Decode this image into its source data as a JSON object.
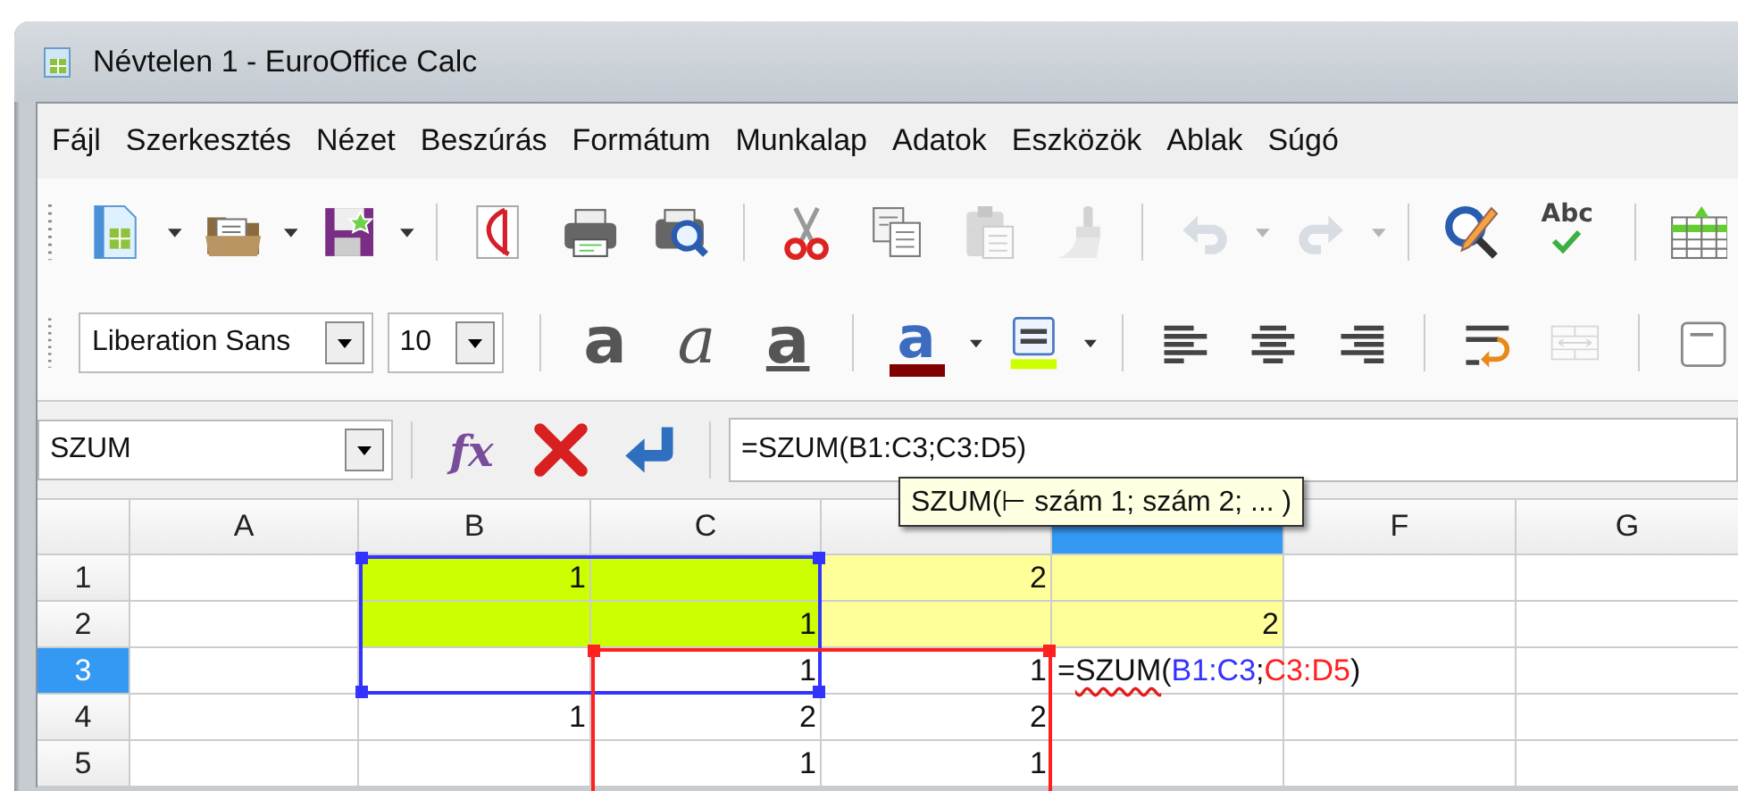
{
  "window": {
    "title": "Névtelen 1 - EuroOffice Calc"
  },
  "menu": [
    "Fájl",
    "Szerkesztés",
    "Nézet",
    "Beszúrás",
    "Formátum",
    "Munkalap",
    "Adatok",
    "Eszközök",
    "Ablak",
    "Súgó"
  ],
  "standard_toolbar": [
    {
      "kind": "new",
      "disabled": false
    },
    {
      "kind": "dropdown",
      "disabled": false
    },
    {
      "kind": "open",
      "disabled": false
    },
    {
      "kind": "dropdown",
      "disabled": false
    },
    {
      "kind": "save",
      "disabled": false
    },
    {
      "kind": "dropdown",
      "disabled": false
    },
    {
      "kind": "separator"
    },
    {
      "kind": "pdf",
      "disabled": false
    },
    {
      "kind": "print",
      "disabled": false
    },
    {
      "kind": "preview",
      "disabled": false
    },
    {
      "kind": "separator"
    },
    {
      "kind": "cut",
      "disabled": false
    },
    {
      "kind": "copy",
      "disabled": false
    },
    {
      "kind": "paste",
      "disabled": true
    },
    {
      "kind": "brush",
      "disabled": true
    },
    {
      "kind": "separator"
    },
    {
      "kind": "undo",
      "disabled": true
    },
    {
      "kind": "dropdown",
      "disabled": true
    },
    {
      "kind": "redo",
      "disabled": true
    },
    {
      "kind": "dropdown",
      "disabled": true
    },
    {
      "kind": "separator"
    },
    {
      "kind": "find",
      "disabled": false
    },
    {
      "kind": "spellcheck",
      "label": "Abc",
      "disabled": false
    },
    {
      "kind": "separator"
    },
    {
      "kind": "table",
      "disabled": false
    }
  ],
  "format_toolbar": [
    {
      "kind": "font-field",
      "value": "Liberation Sans",
      "disabled": false
    },
    {
      "kind": "size-field",
      "value": "10",
      "disabled": false
    },
    {
      "kind": "separator"
    },
    {
      "kind": "bold",
      "label": "a",
      "disabled": false
    },
    {
      "kind": "italic",
      "label": "a",
      "disabled": false
    },
    {
      "kind": "underline",
      "label": "a",
      "disabled": false
    },
    {
      "kind": "separator"
    },
    {
      "kind": "font-color",
      "label": "a",
      "color": "#800000",
      "disabled": false
    },
    {
      "kind": "dropdown",
      "disabled": false
    },
    {
      "kind": "highlight",
      "color": "#ccff00",
      "disabled": false
    },
    {
      "kind": "dropdown",
      "disabled": false
    },
    {
      "kind": "separator"
    },
    {
      "kind": "align-left",
      "disabled": false
    },
    {
      "kind": "align-center",
      "disabled": false
    },
    {
      "kind": "align-right",
      "disabled": false
    },
    {
      "kind": "separator"
    },
    {
      "kind": "wrap",
      "disabled": false
    },
    {
      "kind": "merge",
      "disabled": true
    },
    {
      "kind": "separator"
    },
    {
      "kind": "border",
      "disabled": false
    }
  ],
  "formula_bar": {
    "name_box": "SZUM",
    "function_wizard": "fx",
    "input": "=SZUM(B1:C3;C3:D5)",
    "tooltip": "SZUM(⊢ szám 1; szám 2; ...  )"
  },
  "columns": [
    {
      "label": "A",
      "selected": false
    },
    {
      "label": "B",
      "selected": false
    },
    {
      "label": "C",
      "selected": false
    },
    {
      "selected": false
    },
    {
      "selected": true
    },
    {
      "label": "F",
      "selected": false
    },
    {
      "label": "G",
      "selected": false
    }
  ],
  "rows": [
    {
      "label": "1",
      "selected": false,
      "cells": [
        {},
        {
          "value": "1",
          "color": "#ccff00"
        },
        {
          "color": "#ccff00"
        },
        {
          "value": "2",
          "color": "#ffff99"
        },
        {
          "color": "#ffff99"
        },
        {},
        {}
      ]
    },
    {
      "label": "2",
      "selected": false,
      "cells": [
        {},
        {
          "color": "#ccff00"
        },
        {
          "value": "1",
          "color": "#ccff00"
        },
        {
          "color": "#ffff99"
        },
        {
          "value": "2",
          "color": "#ffff99"
        },
        {},
        {}
      ]
    },
    {
      "label": "3",
      "selected": true,
      "cells": [
        {},
        {},
        {
          "value": "1"
        },
        {
          "value": "1"
        },
        {
          "segments": [
            {
              "text": "="
            },
            {
              "text": "SZUM",
              "spell_error": true
            },
            {
              "text": "("
            },
            {
              "text": "B1:C3",
              "color": "#3333ff",
              "kind": "ref"
            },
            {
              "text": ";"
            },
            {
              "text": "C3:D5",
              "color": "#ff2020",
              "kind": "ref"
            },
            {
              "text": ")"
            }
          ]
        },
        {},
        {}
      ]
    },
    {
      "label": "4",
      "selected": false,
      "cells": [
        {},
        {
          "value": "1"
        },
        {
          "value": "2"
        },
        {
          "value": "2"
        },
        {},
        {},
        {}
      ]
    },
    {
      "label": "5",
      "selected": false,
      "cells": [
        {},
        {},
        {
          "value": "1"
        },
        {
          "value": "1"
        },
        {},
        {},
        {}
      ]
    }
  ]
}
